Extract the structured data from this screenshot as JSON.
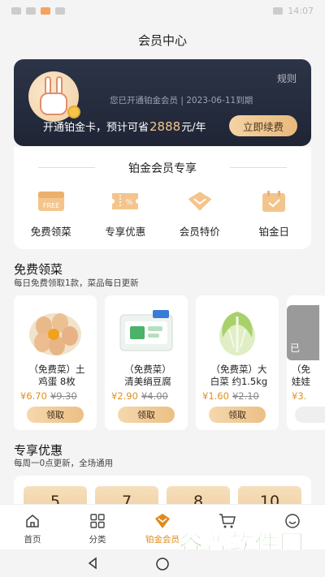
{
  "status_bar": {
    "time": "14:07"
  },
  "header": {
    "title": "会员中心"
  },
  "vip_card": {
    "rules_label": "规则",
    "opened_text": "您已开通铂金会员 | 2023-06-11到期",
    "estimate_prefix": "开通铂金卡，预计可省",
    "estimate_amount": "2888",
    "estimate_suffix": "元/年",
    "renew_button": "立即续费"
  },
  "exclusive": {
    "title": "铂金会员专享",
    "items": [
      {
        "label": "免费领菜",
        "icon": "free-gift-icon",
        "icon_text": "FREE"
      },
      {
        "label": "专享优惠",
        "icon": "coupon-ticket-icon",
        "icon_text": "%"
      },
      {
        "label": "会员特价",
        "icon": "discount-diamond-icon",
        "icon_text": ""
      },
      {
        "label": "铂金日",
        "icon": "calendar-icon",
        "icon_text": ""
      }
    ]
  },
  "free_section": {
    "title": "免费领菜",
    "subtitle": "每日免费领取1款，菜品每日更新",
    "products": [
      {
        "name_line1": "（免费菜）土",
        "name_line2": "鸡蛋 8枚",
        "price": "¥6.70",
        "old_price": "¥9.30",
        "button": "领取",
        "image": "eggs"
      },
      {
        "name_line1": "（免费菜）",
        "name_line2": "清美绢豆腐",
        "price": "¥2.90",
        "old_price": "¥4.00",
        "button": "领取",
        "image": "tofu"
      },
      {
        "name_line1": "（免费菜）大",
        "name_line2": "白菜 约1.5kg",
        "price": "¥1.60",
        "old_price": "¥2.10",
        "button": "领取",
        "image": "cabbage"
      }
    ],
    "partial_product": {
      "tag": "已",
      "name_line1": "（免",
      "name_line2": "娃娃",
      "price": "¥3."
    }
  },
  "coupon_section": {
    "title": "专享优惠",
    "subtitle": "每周一0点更新，全场通用",
    "coupons": [
      "5",
      "7",
      "8",
      "10"
    ]
  },
  "tabbar": {
    "tabs": [
      {
        "label": "首页",
        "icon": "home-icon"
      },
      {
        "label": "分类",
        "icon": "grid-icon"
      },
      {
        "label": "铂金会员",
        "icon": "diamond-icon",
        "active": true
      },
      {
        "label": "",
        "icon": "cart-icon"
      },
      {
        "label": "",
        "icon": "profile-icon"
      }
    ]
  },
  "watermark": {
    "main": "谷普软件园",
    "url": "www.gupuxiazai.com"
  },
  "colors": {
    "accent": "#e08a1c",
    "card_dark": "#262d3f",
    "gold": "#f2c58c"
  }
}
